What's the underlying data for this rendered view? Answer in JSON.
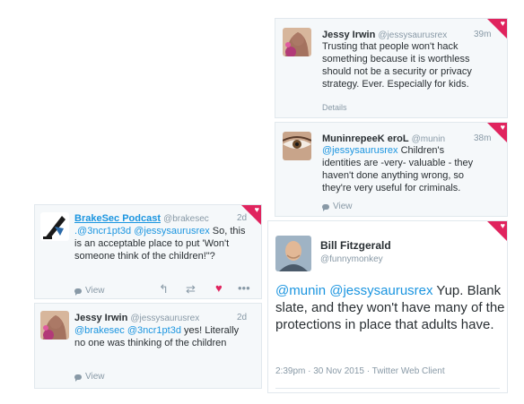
{
  "tweets": [
    {
      "name": "Jessy Irwin",
      "handle": "@jessysaurusrex",
      "time": "39m",
      "text": "Trusting that people won't hack something because it is worthless should not be a security or privacy strategy. Ever. Especially for kids.",
      "footer": "Details"
    },
    {
      "name": "MuninrepeeK eroL",
      "handle": "@munin",
      "time": "38m",
      "mention": "@jessysaurusrex",
      "text": " Children's identities are -very- valuable - they haven't done anything wrong, so they're very useful for criminals.",
      "footer": "View"
    },
    {
      "name": "BrakeSec Podcast",
      "handle": "@brakesec",
      "time": "2d",
      "mention": ".@3ncr1pt3d @jessysaurusrex",
      "text": " So, this is an acceptable place to put 'Won't someone think of the children!\"?",
      "footer": "View"
    },
    {
      "name": "Jessy Irwin",
      "handle": "@jessysaurusrex",
      "time": "2d",
      "mention": "@brakesec @3ncr1pt3d",
      "text": " yes! Literally no one was thinking of the children",
      "footer": "View"
    }
  ],
  "focus": {
    "name": "Bill Fitzgerald",
    "handle": "@funnymonkey",
    "mention": "@munin @jessysaurusrex",
    "text": " Yup. Blank slate, and they won't have many of the protections in place that adults have.",
    "timestamp": "2:39pm · 30 Nov 2015 · Twitter Web Client"
  },
  "actions": {
    "reply_icon": "reply-icon",
    "retweet_icon": "retweet-icon",
    "like_icon": "heart-icon",
    "more_icon": "more-icon"
  },
  "colors": {
    "heart": "#e0245e",
    "link": "#1b95e0",
    "muted": "#8899a6"
  }
}
